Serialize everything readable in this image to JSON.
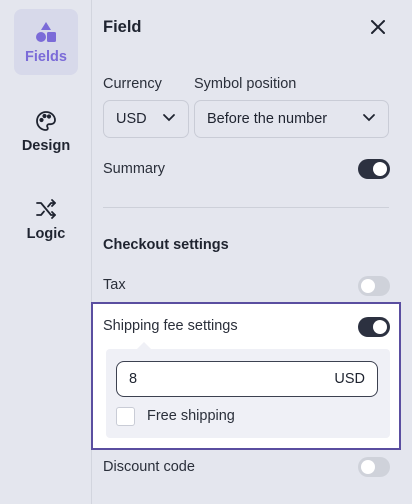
{
  "sidebar": {
    "items": [
      {
        "label": "Fields",
        "icon": "shapes-icon",
        "active": true
      },
      {
        "label": "Design",
        "icon": "palette-icon",
        "active": false
      },
      {
        "label": "Logic",
        "icon": "shuffle-icon",
        "active": false
      }
    ]
  },
  "panel": {
    "title": "Field",
    "currency": {
      "label": "Currency",
      "value": "USD"
    },
    "symbol_position": {
      "label": "Symbol position",
      "value": "Before the number"
    },
    "summary": {
      "label": "Summary",
      "enabled": true
    },
    "checkout": {
      "heading": "Checkout settings",
      "tax": {
        "label": "Tax",
        "enabled": false
      },
      "shipping": {
        "label": "Shipping fee settings",
        "enabled": true,
        "fee_value": "8",
        "fee_unit": "USD",
        "free_shipping_label": "Free shipping",
        "free_shipping_checked": false
      },
      "discount": {
        "label": "Discount code",
        "enabled": false
      }
    }
  },
  "colors": {
    "accent": "#7b6bd8",
    "highlight_border": "#5a4ea0",
    "toggle_on": "#2c3140",
    "toggle_off": "#cfd2da"
  }
}
